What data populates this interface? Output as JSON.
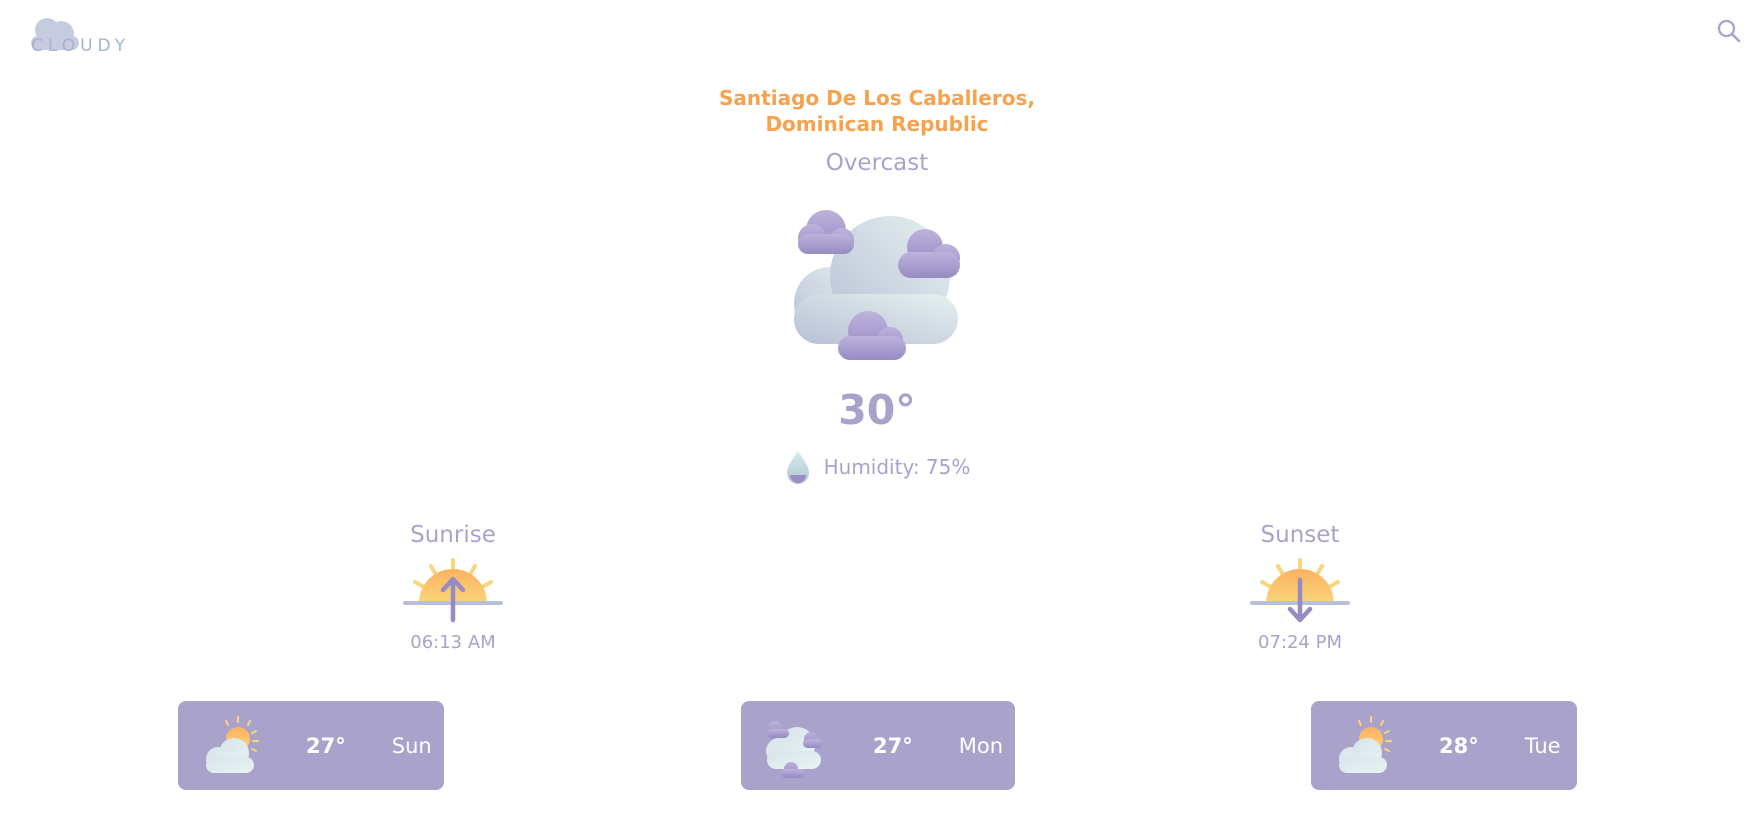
{
  "header": {
    "logo_text": "CLOUDY",
    "search_icon": "search-icon"
  },
  "location": {
    "line1": "Santiago De Los Caballeros,",
    "line2": "Dominican Republic"
  },
  "current": {
    "condition": "Overcast",
    "icon": "overcast-clouds-icon",
    "temperature": "30°",
    "humidity_label": "Humidity: 75%",
    "humidity_icon": "water-drop-icon"
  },
  "sunrise": {
    "title": "Sunrise",
    "time": "06:13 AM",
    "icon": "sunrise-icon"
  },
  "sunset": {
    "title": "Sunset",
    "time": "07:24 PM",
    "icon": "sunset-icon"
  },
  "forecast": [
    {
      "temp": "27°",
      "day": "Sun",
      "icon": "partly-cloudy-icon"
    },
    {
      "temp": "27°",
      "day": "Mon",
      "icon": "overcast-clouds-icon"
    },
    {
      "temp": "28°",
      "day": "Tue",
      "icon": "partly-cloudy-icon"
    }
  ],
  "colors": {
    "accent": "#a9a2cb",
    "location": "#f6a24e",
    "card_text": "#ffffff",
    "sun": "#f9c26a"
  }
}
